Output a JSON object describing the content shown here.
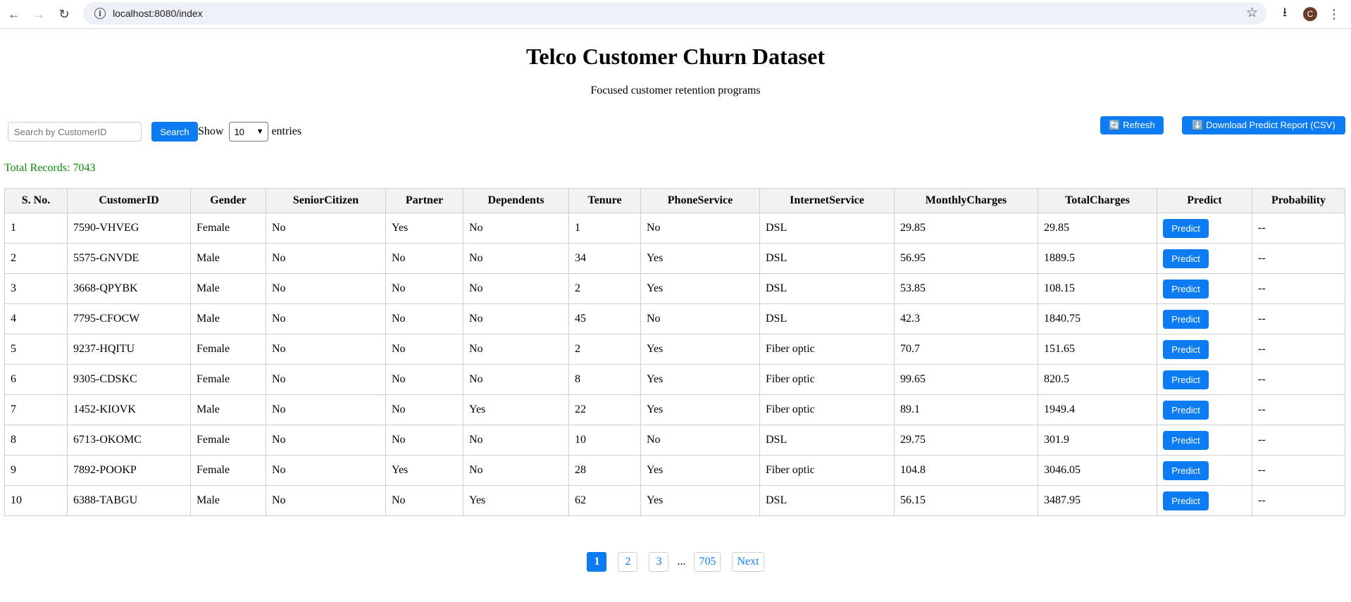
{
  "browser": {
    "url": "localhost:8080/index",
    "profile_initial": "C"
  },
  "header": {
    "title": "Telco Customer Churn Dataset",
    "subtitle": "Focused customer retention programs"
  },
  "controls": {
    "search_placeholder": "Search by CustomerID",
    "search_label": "Search",
    "show_label": "Show",
    "entries_value": "10",
    "entries_label": "entries",
    "refresh_label": "🔄 Refresh",
    "download_label": "⬇️ Download Predict Report (CSV)"
  },
  "summary": {
    "total_records": "Total Records: 7043"
  },
  "table": {
    "columns": [
      "S. No.",
      "CustomerID",
      "Gender",
      "SeniorCitizen",
      "Partner",
      "Dependents",
      "Tenure",
      "PhoneService",
      "InternetService",
      "MonthlyCharges",
      "TotalCharges",
      "Predict",
      "Probability"
    ],
    "predict_label": "Predict",
    "rows": [
      [
        "1",
        "7590-VHVEG",
        "Female",
        "No",
        "Yes",
        "No",
        "1",
        "No",
        "DSL",
        "29.85",
        "29.85",
        "--"
      ],
      [
        "2",
        "5575-GNVDE",
        "Male",
        "No",
        "No",
        "No",
        "34",
        "Yes",
        "DSL",
        "56.95",
        "1889.5",
        "--"
      ],
      [
        "3",
        "3668-QPYBK",
        "Male",
        "No",
        "No",
        "No",
        "2",
        "Yes",
        "DSL",
        "53.85",
        "108.15",
        "--"
      ],
      [
        "4",
        "7795-CFOCW",
        "Male",
        "No",
        "No",
        "No",
        "45",
        "No",
        "DSL",
        "42.3",
        "1840.75",
        "--"
      ],
      [
        "5",
        "9237-HQITU",
        "Female",
        "No",
        "No",
        "No",
        "2",
        "Yes",
        "Fiber optic",
        "70.7",
        "151.65",
        "--"
      ],
      [
        "6",
        "9305-CDSKC",
        "Female",
        "No",
        "No",
        "No",
        "8",
        "Yes",
        "Fiber optic",
        "99.65",
        "820.5",
        "--"
      ],
      [
        "7",
        "1452-KIOVK",
        "Male",
        "No",
        "No",
        "Yes",
        "22",
        "Yes",
        "Fiber optic",
        "89.1",
        "1949.4",
        "--"
      ],
      [
        "8",
        "6713-OKOMC",
        "Female",
        "No",
        "No",
        "No",
        "10",
        "No",
        "DSL",
        "29.75",
        "301.9",
        "--"
      ],
      [
        "9",
        "7892-POOKP",
        "Female",
        "No",
        "Yes",
        "No",
        "28",
        "Yes",
        "Fiber optic",
        "104.8",
        "3046.05",
        "--"
      ],
      [
        "10",
        "6388-TABGU",
        "Male",
        "No",
        "No",
        "Yes",
        "62",
        "Yes",
        "DSL",
        "56.15",
        "3487.95",
        "--"
      ]
    ]
  },
  "pagination": {
    "pages": [
      "1",
      "2",
      "3"
    ],
    "ellipsis": "...",
    "last": "705",
    "next": "Next",
    "active": "1"
  },
  "colors": {
    "accent": "#0d7cf2",
    "total_text": "#0a8a0a"
  }
}
